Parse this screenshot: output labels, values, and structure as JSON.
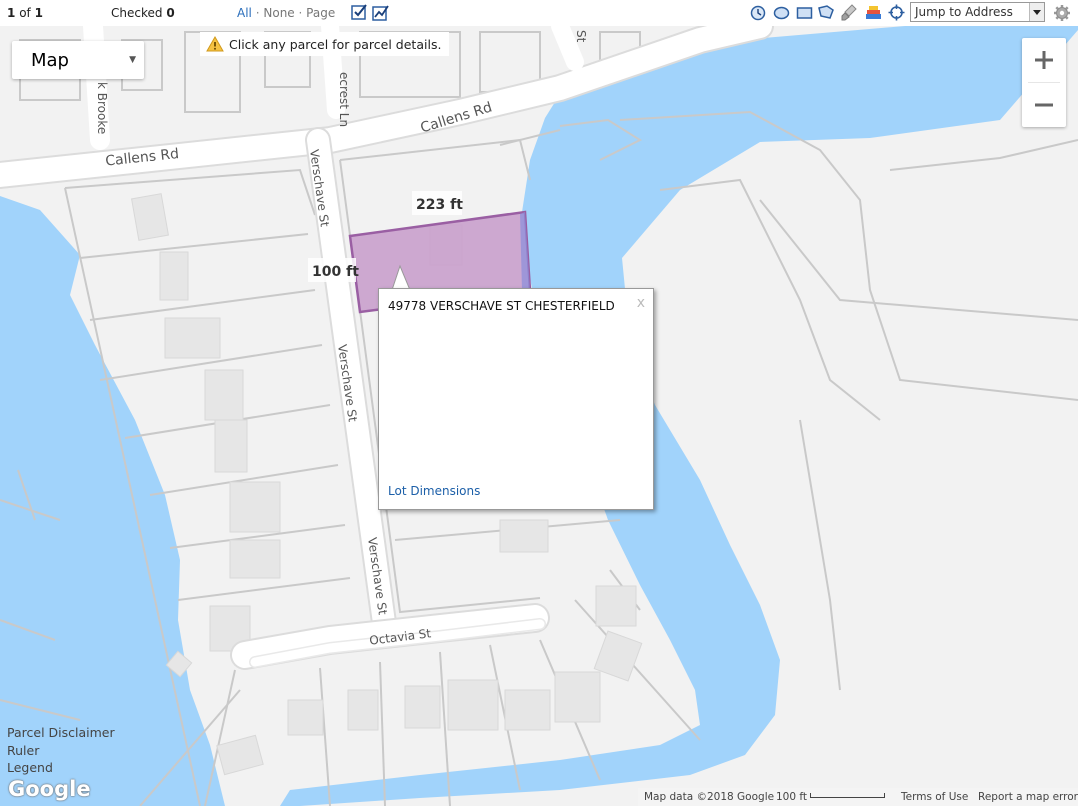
{
  "toolbar": {
    "record_index": "1",
    "record_of": "of",
    "record_total": "1",
    "checked_label": "Checked",
    "checked_count": "0",
    "filters": [
      "All",
      "None",
      "Page"
    ],
    "jump_placeholder": "Jump to Address",
    "tool_icons": [
      "select-checked-icon",
      "select-line-icon",
      "clock-icon",
      "circle-select-icon",
      "rectangle-select-icon",
      "polygon-select-icon",
      "clear-brush-icon",
      "layers-icon",
      "locate-crosshair-icon",
      "gear-icon"
    ]
  },
  "map": {
    "map_type": "Map",
    "hint": "Click any parcel for parcel details.",
    "zoom_in": "+",
    "zoom_out": "−",
    "street_labels": [
      "Callens Rd",
      "Callens Rd",
      "Verschave St",
      "Verschave St",
      "Verschave St",
      "Octavia St",
      "k Brooke",
      "ecrest Ln",
      "St"
    ],
    "measurements": [
      "223 ft",
      "100 ft"
    ],
    "popup": {
      "address": "49778 VERSCHAVE ST CHESTERFIELD",
      "close": "x",
      "link": "Lot Dimensions"
    },
    "side_links": [
      "Parcel Disclaimer",
      "Ruler",
      "Legend"
    ],
    "logo": "Google",
    "footer": {
      "map_data": "Map data ©2018 Google",
      "scale": "100 ft",
      "terms": "Terms of Use",
      "report": "Report a map error"
    },
    "colors": {
      "water": "#a1d3fb",
      "land": "#f2f2f2",
      "road": "#ffffff",
      "parcel_outline": "#c9c9c9",
      "selected_parcel_fill": "#c9a0cc",
      "selected_parcel_border": "#9a5fa3"
    }
  }
}
